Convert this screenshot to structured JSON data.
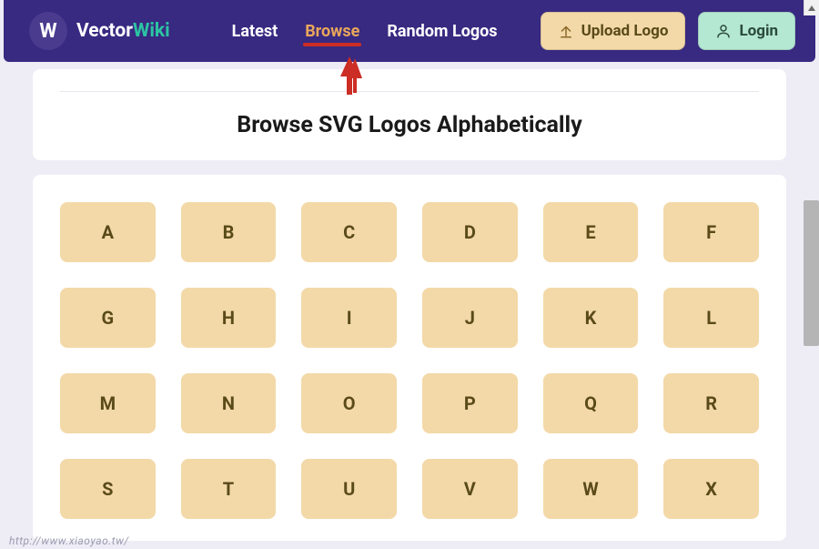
{
  "brand": {
    "logo_letter": "W",
    "name_a": "Vector",
    "name_b": "Wiki"
  },
  "nav": {
    "items": [
      {
        "label": "Latest",
        "active": false
      },
      {
        "label": "Browse",
        "active": true
      },
      {
        "label": "Random Logos",
        "active": false
      }
    ],
    "upload_label": "Upload Logo",
    "login_label": "Login"
  },
  "page": {
    "title": "Browse SVG Logos Alphabetically"
  },
  "letters": [
    "A",
    "B",
    "C",
    "D",
    "E",
    "F",
    "G",
    "H",
    "I",
    "J",
    "K",
    "L",
    "M",
    "N",
    "O",
    "P",
    "Q",
    "R",
    "S",
    "T",
    "U",
    "V",
    "W",
    "X"
  ],
  "watermark": "http://www.xiaoyao.tw/",
  "colors": {
    "navbar": "#382981",
    "accent_active": "#e9a75a",
    "underline": "#cc2d24",
    "tile": "#f3d9a8",
    "login": "#b4e8d3",
    "brand_green": "#2cc4a2"
  }
}
